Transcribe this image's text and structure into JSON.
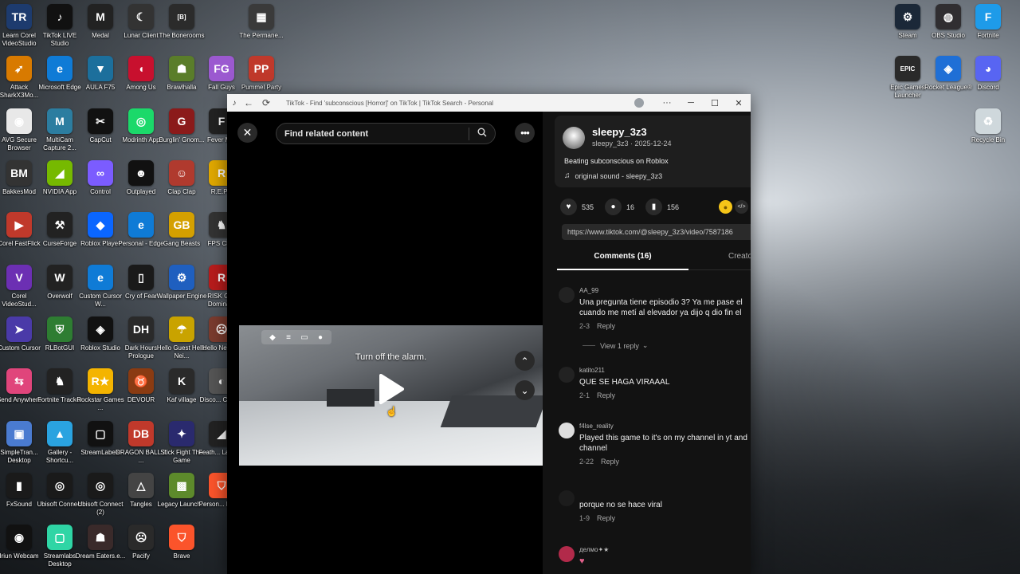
{
  "desktop_icons": [
    {
      "id": "learn-corel",
      "label": "Learn Corel VideoStudio",
      "glyph": "TR",
      "color": "#1d3b6e"
    },
    {
      "id": "tiktok-live-studio",
      "label": "TikTok LIVE Studio",
      "glyph": "♪",
      "color": "#111111"
    },
    {
      "id": "medal",
      "label": "Medal",
      "glyph": "M",
      "color": "#222222"
    },
    {
      "id": "lunar-client",
      "label": "Lunar Client",
      "glyph": "☾",
      "color": "#333333"
    },
    {
      "id": "the-bonerooms",
      "label": "The Bonerooms",
      "glyph": "[B]",
      "color": "#2b2b2b"
    },
    {
      "id": "the-permanence",
      "label": "The Permane...",
      "glyph": "▦",
      "color": "#3a3a3a"
    },
    {
      "id": "attack-shark",
      "label": "Attack SharkX3Mo...",
      "glyph": "➶",
      "color": "#d87a00"
    },
    {
      "id": "microsoft-edge",
      "label": "Microsoft Edge",
      "glyph": "e",
      "color": "#0f7bd6"
    },
    {
      "id": "aula-f75",
      "label": "AULA F75",
      "glyph": "▼",
      "color": "#1c6f9c"
    },
    {
      "id": "among-us",
      "label": "Among Us",
      "glyph": "◖",
      "color": "#c8102e"
    },
    {
      "id": "brawlhalla",
      "label": "Brawlhalla",
      "glyph": "☗",
      "color": "#5a7d2a"
    },
    {
      "id": "fall-guys",
      "label": "Fall Guys",
      "glyph": "FG",
      "color": "#9b59d0"
    },
    {
      "id": "pummel-party",
      "label": "Pummel Party",
      "glyph": "PP",
      "color": "#c0392b"
    },
    {
      "id": "avg-secure-browser",
      "label": "AVG Secure Browser",
      "glyph": "◉",
      "color": "#e8e8e8"
    },
    {
      "id": "multicam-capture",
      "label": "MultiCam Capture 2...",
      "glyph": "M",
      "color": "#2c7da0"
    },
    {
      "id": "capcut",
      "label": "CapCut",
      "glyph": "✂",
      "color": "#111111"
    },
    {
      "id": "modrinth-app",
      "label": "Modrinth App",
      "glyph": "◎",
      "color": "#1bd96a"
    },
    {
      "id": "burglin-gnomes",
      "label": "Burglin' Gnom...",
      "glyph": "G",
      "color": "#8b1a1a"
    },
    {
      "id": "fever-meter",
      "label": "Fever M...",
      "glyph": "F",
      "color": "#222222"
    },
    {
      "id": "bakkesmod",
      "label": "BakkesMod",
      "glyph": "BM",
      "color": "#333333"
    },
    {
      "id": "nvidia-app",
      "label": "NVIDIA App",
      "glyph": "◢",
      "color": "#76b900"
    },
    {
      "id": "control",
      "label": "Control",
      "glyph": "∞",
      "color": "#7b5cff"
    },
    {
      "id": "outplayed",
      "label": "Outplayed",
      "glyph": "☻",
      "color": "#111111"
    },
    {
      "id": "clap-clap",
      "label": "Clap Clap",
      "glyph": "☺",
      "color": "#b03a2e"
    },
    {
      "id": "repo",
      "label": "R.E.P...",
      "glyph": "R",
      "color": "#e0a800"
    },
    {
      "id": "corel-fastflick",
      "label": "Corel FastFlick",
      "glyph": "▶",
      "color": "#c0392b"
    },
    {
      "id": "curseforge",
      "label": "CurseForge",
      "glyph": "⚒",
      "color": "#222222"
    },
    {
      "id": "roblox-player",
      "label": "Roblox Player",
      "glyph": "◆",
      "color": "#0a66ff"
    },
    {
      "id": "personal-edge",
      "label": "Personal - Edge",
      "glyph": "e",
      "color": "#0f7bd6"
    },
    {
      "id": "gang-beasts",
      "label": "Gang Beasts",
      "glyph": "GB",
      "color": "#d4a000"
    },
    {
      "id": "fps-chess",
      "label": "FPS Ch...",
      "glyph": "♞",
      "color": "#333333"
    },
    {
      "id": "corel-videostudio",
      "label": "Corel VideoStud...",
      "glyph": "V",
      "color": "#6c2fb3"
    },
    {
      "id": "overwolf",
      "label": "Overwolf",
      "glyph": "W",
      "color": "#222222"
    },
    {
      "id": "custom-cursor",
      "label": "Custom Cursor W...",
      "glyph": "e",
      "color": "#0f7bd6"
    },
    {
      "id": "cry-of-fear",
      "label": "Cry of Fear",
      "glyph": "▯",
      "color": "#1a1a1a"
    },
    {
      "id": "wallpaper-engine",
      "label": "Wallpaper Engine",
      "glyph": "⚙",
      "color": "#1f5fbf"
    },
    {
      "id": "risk-global",
      "label": "RISK Gl... Domina...",
      "glyph": "R",
      "color": "#b71c1c"
    },
    {
      "id": "custom-cursor-2",
      "label": "Custom Cursor",
      "glyph": "➤",
      "color": "#4a3aa8"
    },
    {
      "id": "rlbotgui",
      "label": "RLBotGUI",
      "glyph": "⛨",
      "color": "#2e7d32"
    },
    {
      "id": "roblox-studio",
      "label": "Roblox Studio",
      "glyph": "◈",
      "color": "#111111"
    },
    {
      "id": "dark-hours",
      "label": "Dark Hours Prologue",
      "glyph": "DH",
      "color": "#2a2a2a"
    },
    {
      "id": "hello-guest",
      "label": "Hello Guest Hello Nei...",
      "glyph": "☂",
      "color": "#c9a300"
    },
    {
      "id": "hello-neighbor",
      "label": "Hello Neigh...",
      "glyph": "☹",
      "color": "#7a3b2e"
    },
    {
      "id": "send-anywhere",
      "label": "Send Anywhere",
      "glyph": "⇆",
      "color": "#e0457b"
    },
    {
      "id": "fortnite-tracker",
      "label": "Fortnite Tracker",
      "glyph": "♞",
      "color": "#222222"
    },
    {
      "id": "rockstar-games",
      "label": "Rockstar Games ...",
      "glyph": "R★",
      "color": "#f4b400"
    },
    {
      "id": "devour",
      "label": "DEVOUR",
      "glyph": "♉",
      "color": "#8a3b12"
    },
    {
      "id": "kaf-village",
      "label": "Kaf village",
      "glyph": "K",
      "color": "#2a2a2a"
    },
    {
      "id": "discord-canary",
      "label": "Disco... Cana...",
      "glyph": "◐",
      "color": "#555555"
    },
    {
      "id": "simpletrans-desktop",
      "label": "SimpleTran... Desktop",
      "glyph": "▣",
      "color": "#4a7bd0"
    },
    {
      "id": "gallery-shortcut",
      "label": "Gallery - Shortcu...",
      "glyph": "▲",
      "color": "#2aa3e0"
    },
    {
      "id": "streamlabels",
      "label": "StreamLabels",
      "glyph": "▢",
      "color": "#111111"
    },
    {
      "id": "dragon-ball",
      "label": "DRAGON BALL Z ...",
      "glyph": "DB",
      "color": "#c0392b"
    },
    {
      "id": "stick-fight",
      "label": "Stick Fight The Game",
      "glyph": "✦",
      "color": "#2a2a6e"
    },
    {
      "id": "feather-launcher",
      "label": "Feath... Launc...",
      "glyph": "◢",
      "color": "#222222"
    },
    {
      "id": "fxsound",
      "label": "FxSound",
      "glyph": "▮",
      "color": "#1a1a1a"
    },
    {
      "id": "ubisoft-connect",
      "label": "Ubisoft Connect",
      "glyph": "◎",
      "color": "#1a1a1a"
    },
    {
      "id": "ubisoft-connect-2",
      "label": "Ubisoft Connect (2)",
      "glyph": "◎",
      "color": "#1a1a1a"
    },
    {
      "id": "tangles",
      "label": "Tangles",
      "glyph": "△",
      "color": "#444444"
    },
    {
      "id": "legacy-launcher",
      "label": "Legacy Launch...",
      "glyph": "▩",
      "color": "#5d8a2b"
    },
    {
      "id": "personal-brave",
      "label": "Person... Brav...",
      "glyph": "⛉",
      "color": "#fb542b"
    },
    {
      "id": "iriun-webcam",
      "label": "Iriun Webcam",
      "glyph": "◉",
      "color": "#111111"
    },
    {
      "id": "streamlabs-desktop",
      "label": "Streamlabs Desktop",
      "glyph": "▢",
      "color": "#2fd5a5"
    },
    {
      "id": "dream-eaters",
      "label": "Dream Eaters.e...",
      "glyph": "☗",
      "color": "#3a2a2a"
    },
    {
      "id": "pacify",
      "label": "Pacify",
      "glyph": "☹",
      "color": "#2a2a2a"
    },
    {
      "id": "brave",
      "label": "Brave",
      "glyph": "⛉",
      "color": "#fb542b"
    },
    {
      "id": "steam",
      "label": "Steam",
      "glyph": "⚙",
      "color": "#1b2838"
    },
    {
      "id": "obs-studio",
      "label": "OBS Studio",
      "glyph": "◍",
      "color": "#302e31"
    },
    {
      "id": "fortnite",
      "label": "Fortnite",
      "glyph": "F",
      "color": "#1e9be9"
    },
    {
      "id": "epic-games-launcher",
      "label": "Epic Games Launcher",
      "glyph": "EPIC",
      "color": "#2a2a2a"
    },
    {
      "id": "rocket-league",
      "label": "Rocket League®",
      "glyph": "◈",
      "color": "#1f6fd6"
    },
    {
      "id": "discord",
      "label": "Discord",
      "glyph": "◕",
      "color": "#5865f2"
    },
    {
      "id": "recycle-bin",
      "label": "Recycle Bin",
      "glyph": "♻",
      "color": "#cfd8dc"
    }
  ],
  "browser": {
    "title": "TikTok - Find 'subconscious [Horror]' on TikTok | TikTok Search - Personal",
    "back_icon": "←",
    "reload_icon": "⟳",
    "more_icon": "···",
    "minimize_icon": "─",
    "maximize_icon": "☐",
    "close_icon": "✕"
  },
  "video": {
    "search_placeholder": "Find related content",
    "caption": "Turn off the alarm.",
    "close_icon": "✕",
    "more_icon": "•••",
    "up_icon": "⌃",
    "down_icon": "⌄"
  },
  "post": {
    "username": "sleepy_3z3",
    "subline": "sleepy_3z3 · 2025-12-24",
    "description": "Beating subconscious on Roblox",
    "sound": "original sound - sleepy_3z3",
    "likes": "535",
    "comments_count": "16",
    "saves": "156",
    "link": "https://www.tiktok.com/@sleepy_3z3/video/7587186",
    "tab_comments": "Comments (16)",
    "tab_creator": "Creator videos"
  },
  "comments": [
    {
      "name": "AA_99",
      "text1": "Una pregunta tiene episodio 3? Ya me pase el",
      "text2": "cuando me metí al elevador ya dijo q dio fin el",
      "date": "2-3",
      "reply": "Reply"
    },
    {
      "name": "katito211",
      "text1": "QUE SE HAGA VIRAAAL",
      "text2": "",
      "date": "2-1",
      "reply": "Reply"
    },
    {
      "name": "f4lse_reality",
      "text1": "Played this game to it's on my channel in yt and",
      "text2": "channel",
      "date": "2-22",
      "reply": "Reply"
    },
    {
      "name": "",
      "text1": "porque no se hace viral",
      "text2": "",
      "date": "1-9",
      "reply": "Reply"
    },
    {
      "name": "делмо✦★",
      "text1": "",
      "text2": "",
      "date": "",
      "reply": ""
    }
  ],
  "view_replies": "View 1 reply"
}
